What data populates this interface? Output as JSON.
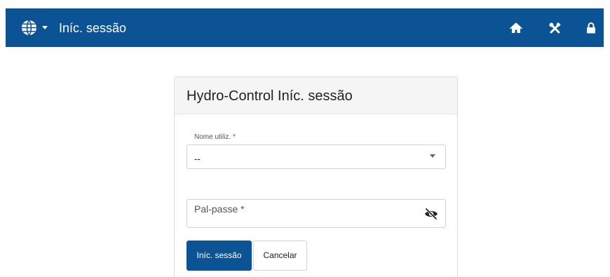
{
  "topbar": {
    "title": "Iníc. sessão",
    "language_icon": "globe-icon",
    "icons": [
      "home-icon",
      "tools-icon",
      "lock-icon"
    ],
    "color": "#0b5394"
  },
  "login": {
    "title": "Hydro-Control Iníc. sessão",
    "username": {
      "label": "Nome utiliz. *",
      "value": "--"
    },
    "password": {
      "placeholder": "Pal-passe *",
      "toggle_icon": "eye-slash-icon"
    },
    "buttons": {
      "submit": "Iníc. sessão",
      "cancel": "Cancelar"
    }
  }
}
